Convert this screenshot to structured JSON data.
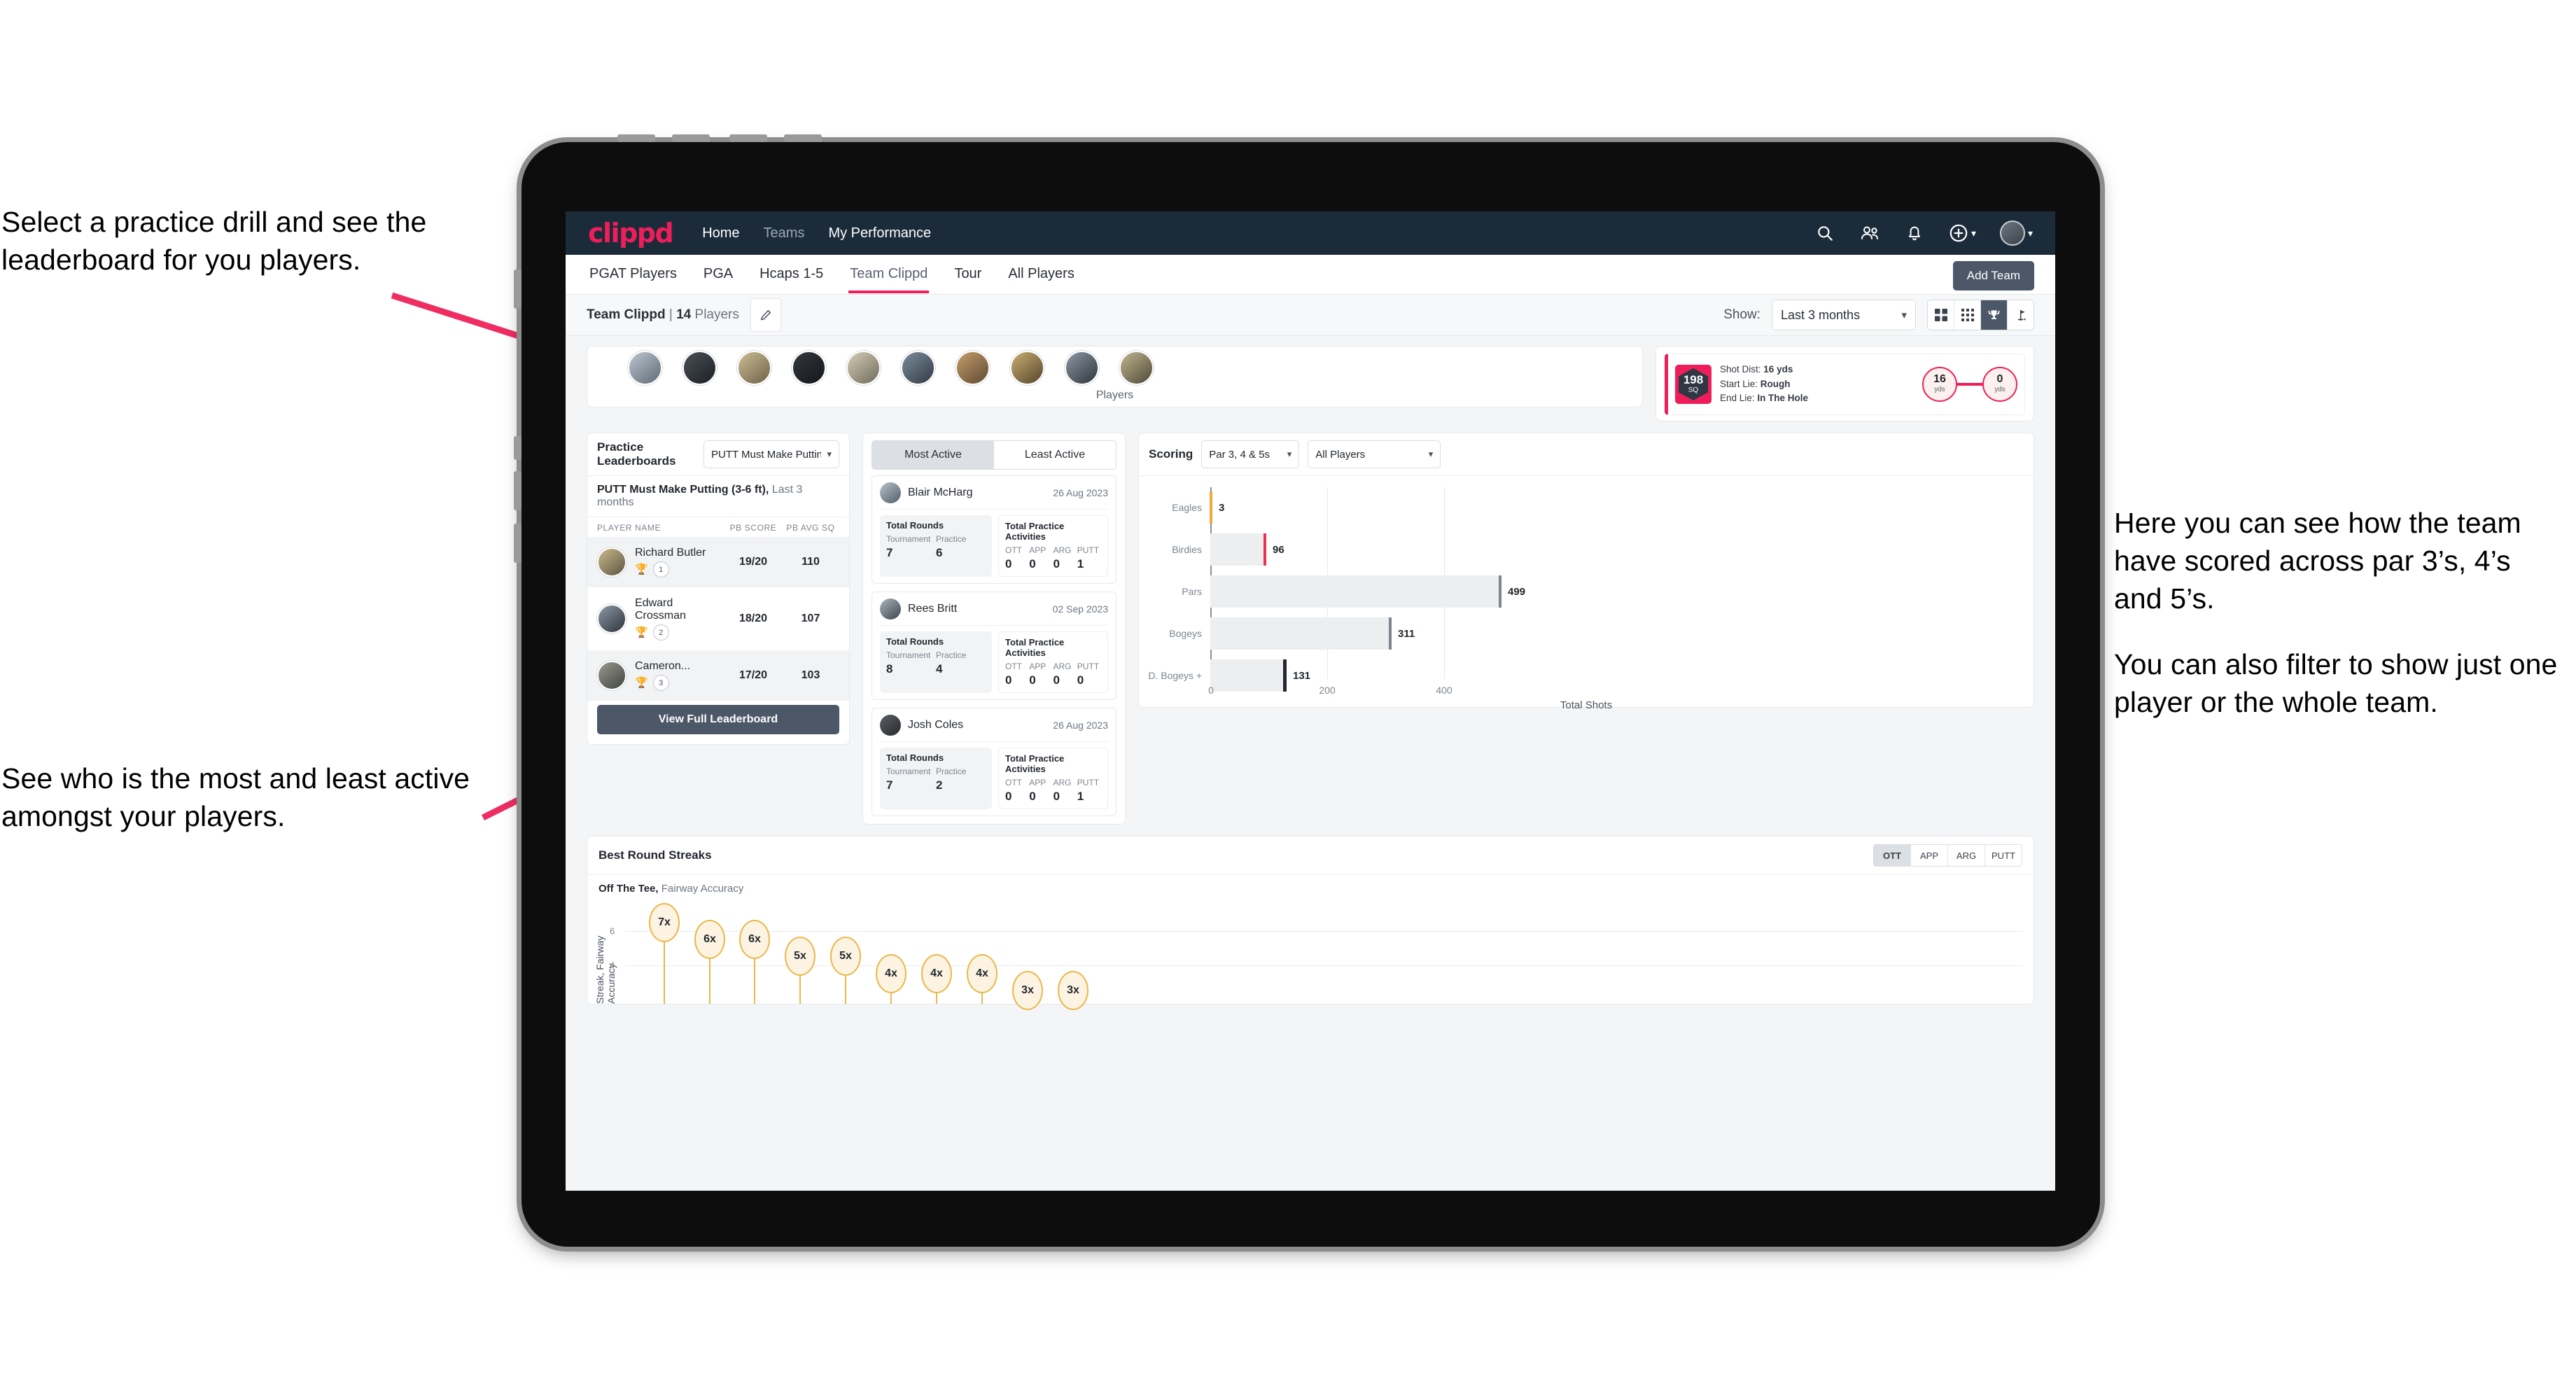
{
  "annotations": {
    "left_top": "Select a practice drill and see the leaderboard for you players.",
    "left_bottom": "See who is the most and least active amongst your players.",
    "right_p1": "Here you can see how the team have scored across par 3’s, 4’s and 5’s.",
    "right_p2": "You can also filter to show just one player or the whole team."
  },
  "topnav": {
    "logo": "clippd",
    "links": [
      {
        "label": "Home",
        "dim": false
      },
      {
        "label": "Teams",
        "dim": true
      },
      {
        "label": "My Performance",
        "dim": false
      }
    ],
    "icons": [
      "search-icon",
      "people-icon",
      "bell-icon",
      "plus-circle-icon",
      "avatar"
    ]
  },
  "tabs": [
    {
      "label": "PGAT Players",
      "active": false
    },
    {
      "label": "PGA",
      "active": false
    },
    {
      "label": "Hcaps 1-5",
      "active": false
    },
    {
      "label": "Team Clippd",
      "active": true
    },
    {
      "label": "Tour",
      "active": false
    },
    {
      "label": "All Players",
      "active": false
    }
  ],
  "add_team_label": "Add Team",
  "subheader": {
    "team_name": "Team Clippd",
    "separator": " | ",
    "player_count": "14",
    "players_word": " Players",
    "edit_icon": "pencil-icon",
    "show_label": "Show:",
    "range_value": "Last 3 months",
    "view_buttons": [
      {
        "name": "grid-4-icon",
        "active": false
      },
      {
        "name": "grid-9-icon",
        "active": false
      },
      {
        "name": "trophy-icon",
        "active": true
      },
      {
        "name": "flag-icon",
        "active": false
      }
    ]
  },
  "players_strip": {
    "caption": "Players",
    "avatar_count": 10
  },
  "shot_card": {
    "badge_value": "198",
    "badge_unit": "SQ",
    "rows": [
      {
        "label": "Shot Dist:",
        "value": "16 yds"
      },
      {
        "label": "Start Lie:",
        "value": "Rough"
      },
      {
        "label": "End Lie:",
        "value": "In The Hole"
      }
    ],
    "start_dot": {
      "value": "16",
      "unit": "yds"
    },
    "end_dot": {
      "value": "0",
      "unit": "yds"
    }
  },
  "leaderboard": {
    "title": "Practice Leaderboards",
    "drill_select": "PUTT Must Make Putting ...",
    "subtitle_bold": "PUTT Must Make Putting (3-6 ft),",
    "subtitle_muted": " Last 3 months",
    "columns": [
      "PLAYER NAME",
      "PB SCORE",
      "PB AVG SQ"
    ],
    "rows": [
      {
        "name": "Richard Butler",
        "rank": "1",
        "trophy": "gold",
        "pb_score": "19/20",
        "pb_avg_sq": "110"
      },
      {
        "name": "Edward Crossman",
        "rank": "2",
        "trophy": "silver",
        "pb_score": "18/20",
        "pb_avg_sq": "107"
      },
      {
        "name": "Cameron...",
        "rank": "3",
        "trophy": "bronze",
        "pb_score": "17/20",
        "pb_avg_sq": "103"
      }
    ],
    "button_label": "View Full Leaderboard"
  },
  "activity": {
    "tabs": [
      {
        "label": "Most Active",
        "active": true
      },
      {
        "label": "Least Active",
        "active": false
      }
    ],
    "rounds_title": "Total Rounds",
    "rounds_keys": [
      "Tournament",
      "Practice"
    ],
    "acts_title": "Total Practice Activities",
    "acts_keys": [
      "OTT",
      "APP",
      "ARG",
      "PUTT"
    ],
    "cards": [
      {
        "name": "Blair McHarg",
        "date": "26 Aug 2023",
        "rounds": [
          "7",
          "6"
        ],
        "acts": [
          "0",
          "0",
          "0",
          "1"
        ]
      },
      {
        "name": "Rees Britt",
        "date": "02 Sep 2023",
        "rounds": [
          "8",
          "4"
        ],
        "acts": [
          "0",
          "0",
          "0",
          "0"
        ]
      },
      {
        "name": "Josh Coles",
        "date": "26 Aug 2023",
        "rounds": [
          "7",
          "2"
        ],
        "acts": [
          "0",
          "0",
          "0",
          "1"
        ]
      }
    ]
  },
  "scoring": {
    "title": "Scoring",
    "par_select": "Par 3, 4 & 5s",
    "player_select": "All Players"
  },
  "streaks": {
    "title": "Best Round Streaks",
    "toggle": [
      {
        "label": "OTT",
        "active": true
      },
      {
        "label": "APP",
        "active": false
      },
      {
        "label": "ARG",
        "active": false
      },
      {
        "label": "PUTT",
        "active": false
      }
    ],
    "sub_bold": "Off The Tee,",
    "sub_muted": " Fairway Accuracy"
  },
  "colors": {
    "brand_pink": "#ef1e5a",
    "nav_dark": "#1b2b3a",
    "slate": "#4c5867",
    "amber": "#eab84a"
  },
  "chart_data": [
    {
      "type": "bar",
      "orientation": "horizontal",
      "title": "Scoring",
      "categories": [
        "Eagles",
        "Birdies",
        "Pars",
        "Bogeys",
        "D. Bogeys +"
      ],
      "values": [
        3,
        96,
        499,
        311,
        131
      ],
      "cap_colors": [
        "#eea93a",
        "#e8354e",
        "#7d858e",
        "#7d858e",
        "#22272e"
      ],
      "xlabel": "Total Shots",
      "ylabel": "",
      "xticks": [
        0,
        200,
        400
      ],
      "xlim": [
        0,
        540
      ],
      "grid": true,
      "legend": "none"
    },
    {
      "type": "bar",
      "orientation": "vertical",
      "title": "Best Round Streaks",
      "subtitle": "Off The Tee, Fairway Accuracy",
      "categories": [
        "",
        "",
        "",
        "",
        "",
        "",
        "",
        "",
        "",
        ""
      ],
      "values": [
        7,
        6,
        6,
        5,
        5,
        4,
        4,
        4,
        3,
        3
      ],
      "point_labels": [
        "7x",
        "6x",
        "6x",
        "5x",
        "5x",
        "4x",
        "4x",
        "4x",
        "3x",
        "3x"
      ],
      "ylabel": "Streak, Fairway Accuracy",
      "yticks": [
        4,
        6
      ],
      "ylim": [
        0,
        7.8
      ],
      "grid": true,
      "legend": "none"
    }
  ]
}
